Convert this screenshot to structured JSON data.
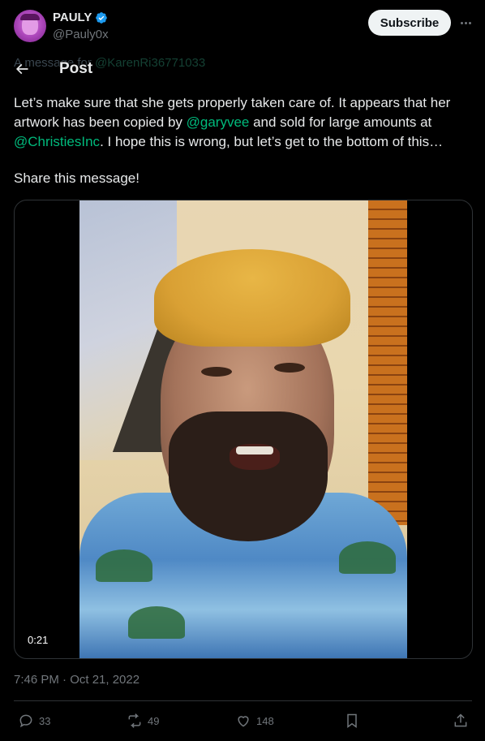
{
  "author": {
    "name": "PAULY",
    "handle": "@Pauly0x",
    "subscribe_label": "Subscribe"
  },
  "nav": {
    "title": "Post",
    "ghost_prefix": "A message for ",
    "ghost_mention": "@KarenRi36771033"
  },
  "tweet": {
    "text_1": "Let’s make sure that she gets properly taken care of. It appears that her artwork has been copied by ",
    "mention_1": "@garyvee",
    "text_2": " and sold for large amounts at ",
    "mention_2": "@ChristiesInc",
    "text_3": ". I hope this is wrong, but let’s get to the bottom of this…",
    "share": "Share this message!",
    "video_duration": "0:21",
    "timestamp": "7:46 PM · Oct 21, 2022"
  },
  "actions": {
    "replies": "33",
    "reposts": "49",
    "likes": "148"
  },
  "icons": {
    "verified": "verified-badge-icon",
    "back": "back-arrow-icon",
    "more": "more-dots-icon",
    "reply": "reply-icon",
    "repost": "repost-icon",
    "like": "heart-icon",
    "bookmark": "bookmark-icon",
    "share": "share-icon"
  },
  "colors": {
    "background": "#000000",
    "mention": "#00ba7c",
    "verified": "#1d9bf0",
    "muted": "#71767b"
  }
}
